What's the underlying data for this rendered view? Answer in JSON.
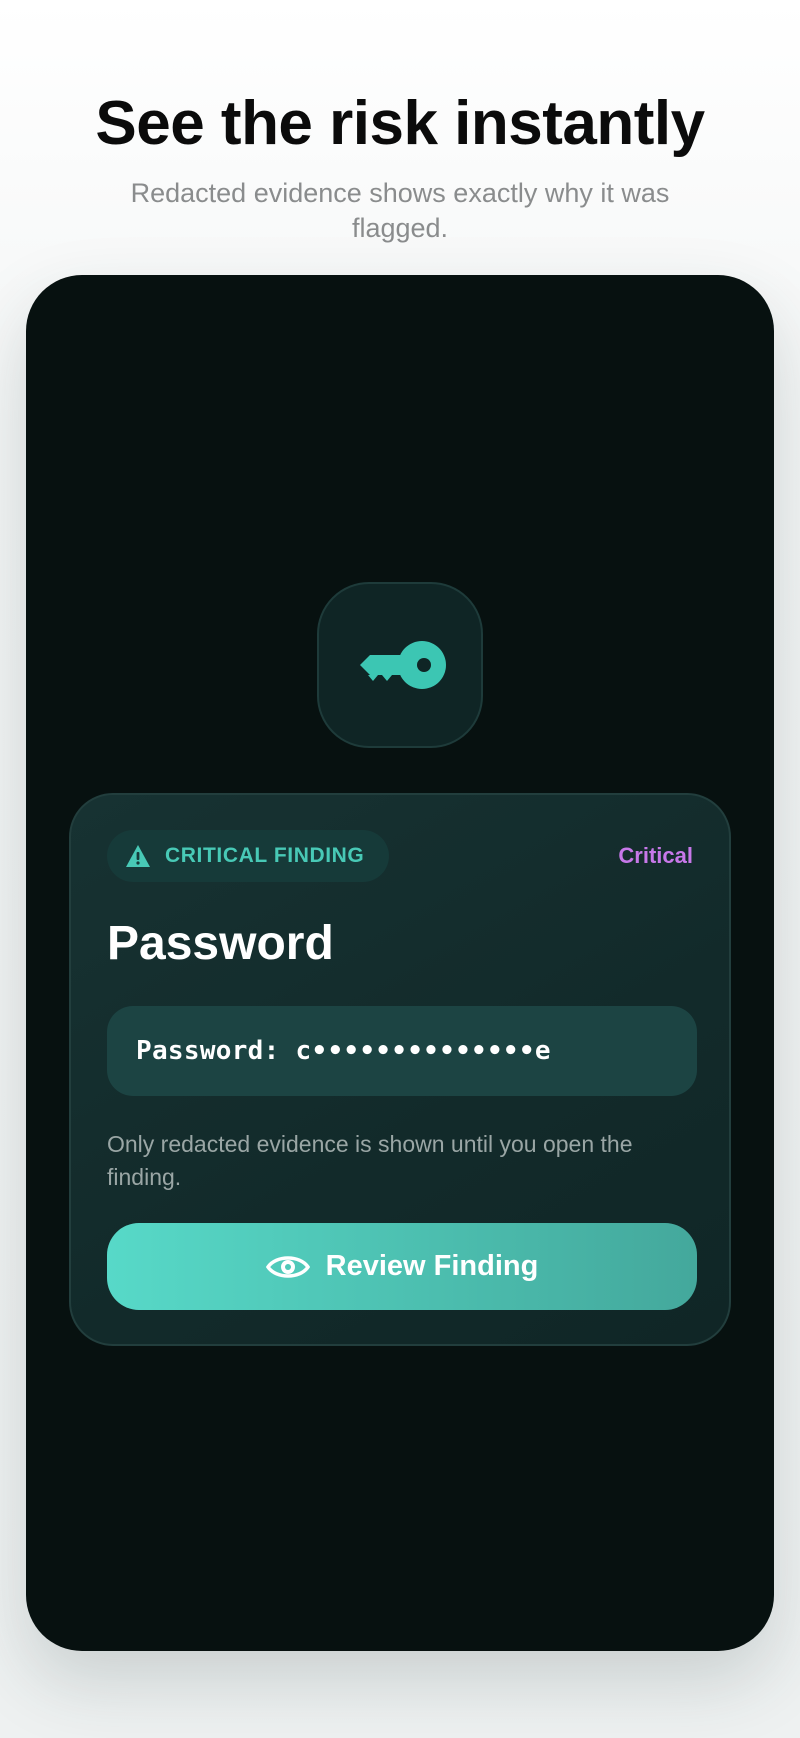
{
  "header": {
    "title": "See the risk instantly",
    "subtitle": "Redacted evidence shows exactly why it was flagged."
  },
  "app_icon": {
    "icon": "key-icon"
  },
  "finding": {
    "badge_icon": "warning-triangle-icon",
    "badge_label": "CRITICAL FINDING",
    "severity": "Critical",
    "title": "Password",
    "evidence": "Password: c••••••••••••••e",
    "note": "Only redacted evidence is shown until you open the finding.",
    "action_icon": "eye-icon",
    "action_label": "Review Finding"
  },
  "colors": {
    "accent": "#48c9b6",
    "severity": "#c778e9",
    "device_bg": "#071110",
    "card_bg": "#173232"
  }
}
